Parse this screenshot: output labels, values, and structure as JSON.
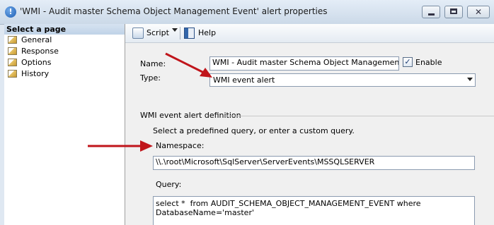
{
  "window": {
    "title": "'WMI - Audit master Schema Object Management Event' alert properties",
    "icon": "alert-icon"
  },
  "sidebar": {
    "header": "Select a page",
    "items": [
      {
        "label": "General",
        "icon": "page-icon"
      },
      {
        "label": "Response",
        "icon": "page-icon"
      },
      {
        "label": "Options",
        "icon": "page-icon"
      },
      {
        "label": "History",
        "icon": "page-icon"
      }
    ]
  },
  "toolbar": {
    "script_label": "Script",
    "help_label": "Help"
  },
  "form": {
    "name_label": "Name:",
    "name_value": "WMI - Audit master Schema Object Management Event",
    "enable_label": "Enable",
    "enable_checked": true,
    "type_label": "Type:",
    "type_value": "WMI event alert",
    "section_title": "WMI event alert definition",
    "instruction": "Select a predefined query, or enter a custom query.",
    "namespace_label": "Namespace:",
    "namespace_value": "\\\\.\\root\\Microsoft\\SqlServer\\ServerEvents\\MSSQLSERVER",
    "query_label": "Query:",
    "query_value": "select *  from AUDIT_SCHEMA_OBJECT_MANAGEMENT_EVENT where\nDatabaseName='master'"
  },
  "colors": {
    "annotation_arrow": "#c0151b"
  }
}
